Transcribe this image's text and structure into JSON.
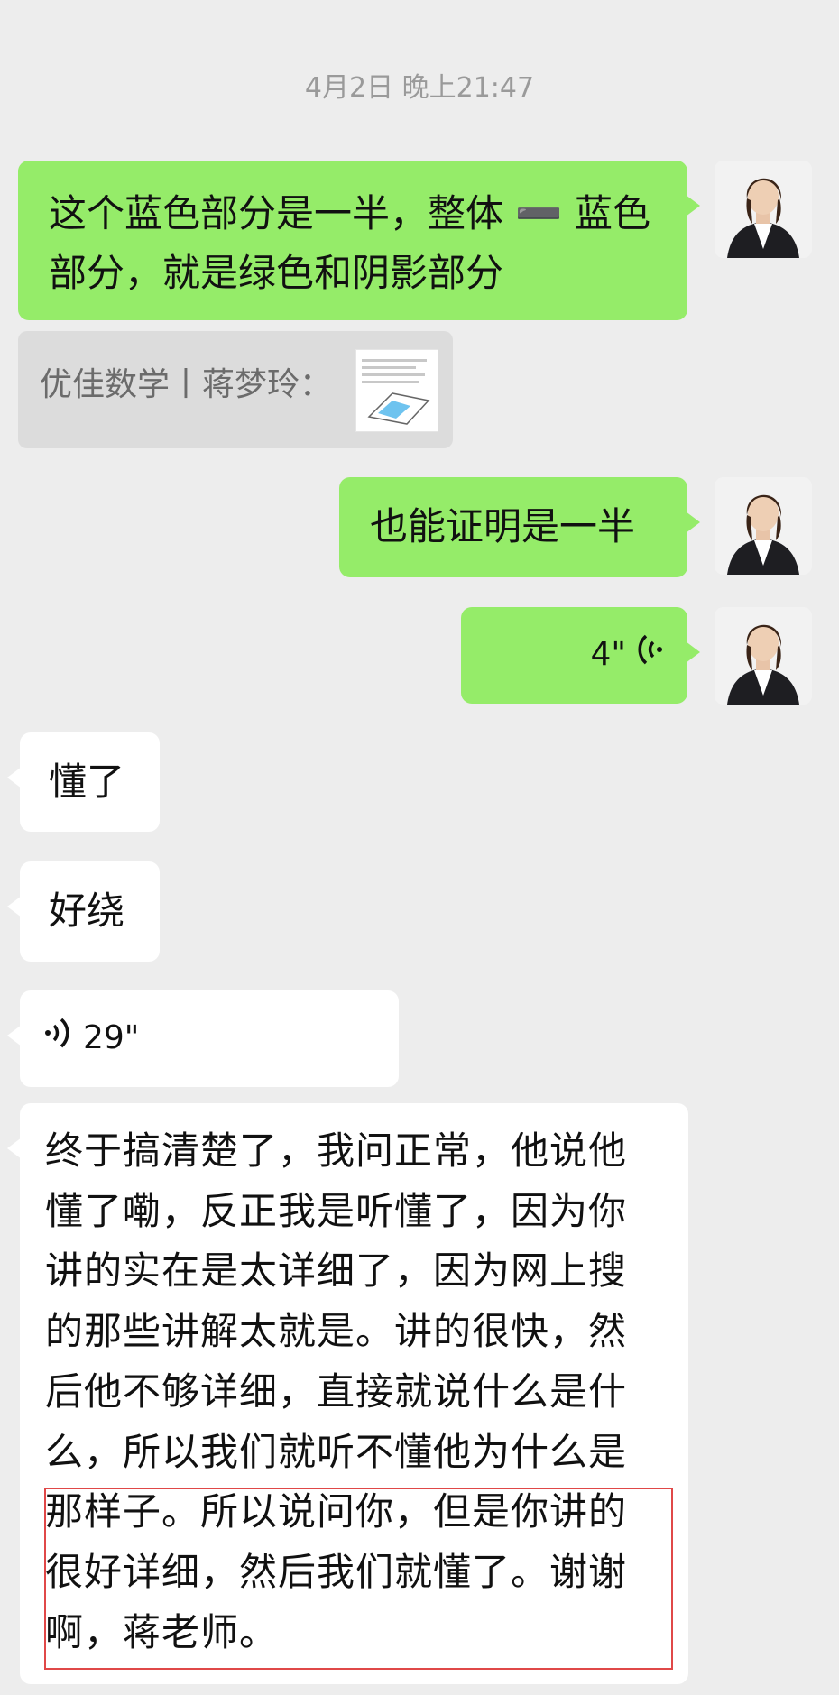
{
  "chat": {
    "timestamp": "4月2日 晚上21:47",
    "messages": [
      {
        "side": "right",
        "type": "text",
        "text": "这个蓝色部分是一半，整体 ➖ 蓝色部分，就是绿色和阴影部分"
      },
      {
        "type": "quote",
        "text": "优佳数学丨蒋梦玲："
      },
      {
        "side": "right",
        "type": "text",
        "text": "也能证明是一半"
      },
      {
        "side": "right",
        "type": "voice",
        "duration": "4\""
      },
      {
        "side": "left",
        "type": "text",
        "text": "懂了"
      },
      {
        "side": "left",
        "type": "text",
        "text": "好绕"
      },
      {
        "side": "left",
        "type": "voice",
        "duration": "29\""
      },
      {
        "side": "left",
        "type": "text",
        "text": "终于搞清楚了，我问正常，他说他懂了嘞，反正我是听懂了，因为你讲的实在是太详细了，因为网上搜的那些讲解太就是。讲的很快，然后他不够详细，直接就说什么是什么，所以我们就听不懂他为什么是那样子。所以说问你，但是你讲的很好详细，然后我们就懂了。谢谢啊，蒋老师。"
      }
    ]
  },
  "colors": {
    "background": "#ededed",
    "right_bubble": "#95ec69",
    "left_bubble": "#ffffff",
    "highlight": "#e04848"
  },
  "icons": {
    "voice": "voice-wave-icon"
  }
}
